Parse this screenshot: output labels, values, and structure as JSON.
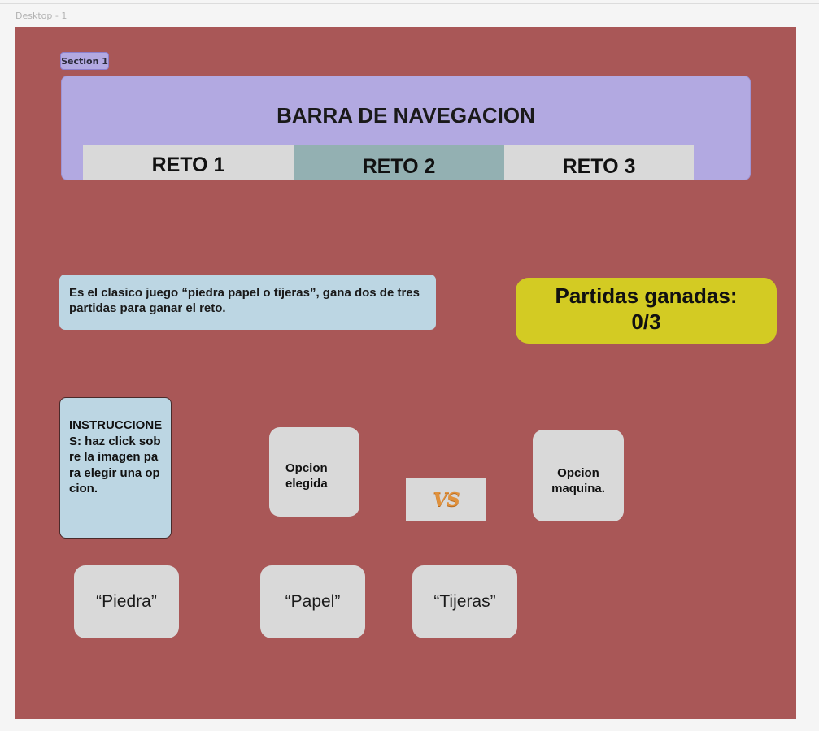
{
  "canvas": {
    "frame_label": "Desktop - 1",
    "section_label": "Section 1"
  },
  "navbar": {
    "title": "BARRA DE NAVEGACION",
    "tabs": [
      {
        "label": "RETO 1"
      },
      {
        "label": "RETO 2",
        "active": true
      },
      {
        "label": "RETO 3"
      }
    ]
  },
  "description": "Es el clasico juego “piedra papel o tijeras”, gana dos de tres partidas para ganar el reto.",
  "score": {
    "label": "Partidas ganadas:",
    "value": "0/3"
  },
  "instructions": "INSTRUCCIONES: haz click sobre la imagen para elegir una opcion.",
  "game": {
    "chosen_option": "Opcion elegida",
    "versus": "VS",
    "machine_option": "Opcion maquina."
  },
  "choices": [
    {
      "label": "“Piedra”"
    },
    {
      "label": "“Papel”"
    },
    {
      "label": "“Tijeras”"
    }
  ],
  "colors": {
    "frame_bg": "#a95757",
    "navbar_bg": "#b2a9e1",
    "active_tab": "#93b0b2",
    "tab_bg": "#d9d9d9",
    "info_bg": "#bcd6e3",
    "score_bg": "#d3cb23",
    "vs_text": "#e0913c"
  }
}
